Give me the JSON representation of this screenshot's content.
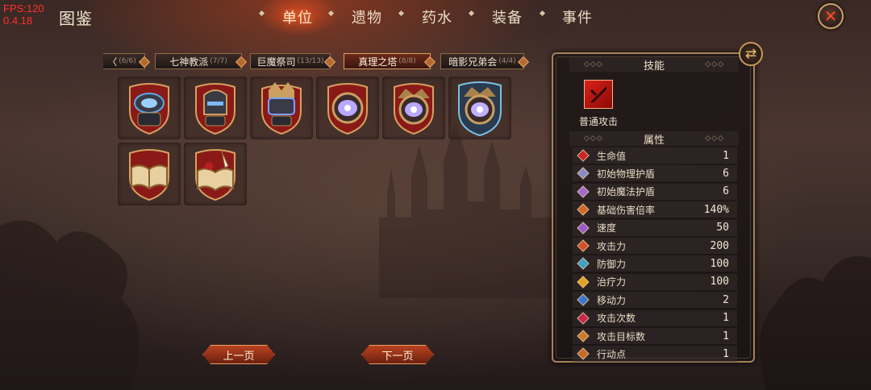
{
  "debug": {
    "fps": "FPS:120",
    "version": "0.4.18"
  },
  "title": "图鉴",
  "nav": {
    "tabs": [
      {
        "label": "单位",
        "active": true
      },
      {
        "label": "遗物",
        "active": false
      },
      {
        "label": "药水",
        "active": false
      },
      {
        "label": "装备",
        "active": false
      },
      {
        "label": "事件",
        "active": false
      }
    ]
  },
  "factions": [
    {
      "name": "〈",
      "count": "(6/6)"
    },
    {
      "name": "七神教派",
      "count": "(7/7)"
    },
    {
      "name": "巨魔祭司",
      "count": "(13/13)"
    },
    {
      "name": "真理之塔",
      "count": "(8/8)",
      "active": true
    },
    {
      "name": "暗影兄弟会",
      "count": "(4/4)"
    }
  ],
  "units": [
    {
      "icon": "armored-golem-icon"
    },
    {
      "icon": "dark-knight-helm-icon"
    },
    {
      "icon": "crowned-golem-icon"
    },
    {
      "icon": "all-seeing-eye-icon"
    },
    {
      "icon": "ornate-eye-icon"
    },
    {
      "icon": "arcane-eye-crest-icon"
    },
    {
      "icon": "open-tome-icon"
    },
    {
      "icon": "quill-tome-icon"
    }
  ],
  "pager": {
    "prev": "上一页",
    "next": "下一页"
  },
  "panel": {
    "skills_header": "技能",
    "dots": "◇◇◇",
    "skill": {
      "label": "普通攻击",
      "icon": "sword-attack-icon"
    },
    "attrs_header": "属性",
    "stats": [
      {
        "label": "生命值",
        "value": "1",
        "icon": "heart-icon",
        "color": "#c8242a"
      },
      {
        "label": "初始物理护盾",
        "value": "6",
        "icon": "physical-shield-icon",
        "color": "#8a8ac8"
      },
      {
        "label": "初始魔法护盾",
        "value": "6",
        "icon": "magic-shield-icon",
        "color": "#a46ad0"
      },
      {
        "label": "基础伤害倍率",
        "value": "140%",
        "icon": "damage-multiplier-icon",
        "color": "#d06a2a"
      },
      {
        "label": "速度",
        "value": "50",
        "icon": "speed-icon",
        "color": "#9a5ad0"
      },
      {
        "label": "攻击力",
        "value": "200",
        "icon": "attack-icon",
        "color": "#d0502a"
      },
      {
        "label": "防御力",
        "value": "100",
        "icon": "defense-icon",
        "color": "#3aa0c8"
      },
      {
        "label": "治疗力",
        "value": "100",
        "icon": "heal-icon",
        "color": "#e0a020"
      },
      {
        "label": "移动力",
        "value": "2",
        "icon": "move-icon",
        "color": "#3a78d0"
      },
      {
        "label": "攻击次数",
        "value": "1",
        "icon": "attack-count-icon",
        "color": "#c8284a"
      },
      {
        "label": "攻击目标数",
        "value": "1",
        "icon": "target-count-icon",
        "color": "#c87a2a"
      },
      {
        "label": "行动点",
        "value": "1",
        "icon": "action-point-icon",
        "color": "#c86a2a"
      }
    ]
  }
}
